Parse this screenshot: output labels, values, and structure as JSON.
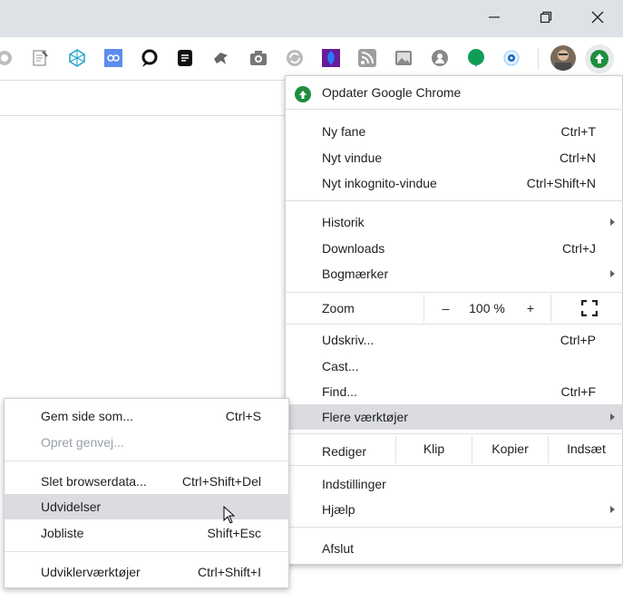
{
  "colors": {
    "titlebar": "#dee1e6",
    "update": "#1e8e3e",
    "highlight": "#dadce0"
  },
  "window_controls": [
    {
      "icon": "minimize-icon"
    },
    {
      "icon": "maximize-icon"
    },
    {
      "icon": "close-icon"
    }
  ],
  "extensions": [
    "puzzle-icon",
    "note-icon",
    "network-icon",
    "link-icon",
    "chat-icon",
    "doc-icon",
    "bird-icon",
    "camera-icon",
    "sync-icon",
    "shield-icon",
    "rss-icon",
    "image-icon",
    "person-icon",
    "hangouts-icon",
    "eye-icon"
  ],
  "main_menu": {
    "update": "Opdater Google Chrome",
    "new_tab": {
      "label": "Ny fane",
      "shortcut": "Ctrl+T"
    },
    "new_window": {
      "label": "Nyt vindue",
      "shortcut": "Ctrl+N"
    },
    "incognito": {
      "label": "Nyt inkognito-vindue",
      "shortcut": "Ctrl+Shift+N"
    },
    "history": {
      "label": "Historik"
    },
    "downloads": {
      "label": "Downloads",
      "shortcut": "Ctrl+J"
    },
    "bookmarks": {
      "label": "Bogmærker"
    },
    "zoom": {
      "label": "Zoom",
      "minus": "–",
      "value": "100 %",
      "plus": "+"
    },
    "print": {
      "label": "Udskriv...",
      "shortcut": "Ctrl+P"
    },
    "cast": {
      "label": "Cast..."
    },
    "find": {
      "label": "Find...",
      "shortcut": "Ctrl+F"
    },
    "more_tools": {
      "label": "Flere værktøjer"
    },
    "edit": {
      "label": "Rediger",
      "cut": "Klip",
      "copy": "Kopier",
      "paste": "Indsæt"
    },
    "settings": {
      "label": "Indstillinger"
    },
    "help": {
      "label": "Hjælp"
    },
    "exit": {
      "label": "Afslut"
    }
  },
  "submenu": {
    "save_page": {
      "label": "Gem side som...",
      "shortcut": "Ctrl+S"
    },
    "create_shortcut": {
      "label": "Opret genvej..."
    },
    "clear_data": {
      "label": "Slet browserdata...",
      "shortcut": "Ctrl+Shift+Del"
    },
    "extensions": {
      "label": "Udvidelser"
    },
    "task_manager": {
      "label": "Jobliste",
      "shortcut": "Shift+Esc"
    },
    "dev_tools": {
      "label": "Udviklerværktøjer",
      "shortcut": "Ctrl+Shift+I"
    }
  }
}
